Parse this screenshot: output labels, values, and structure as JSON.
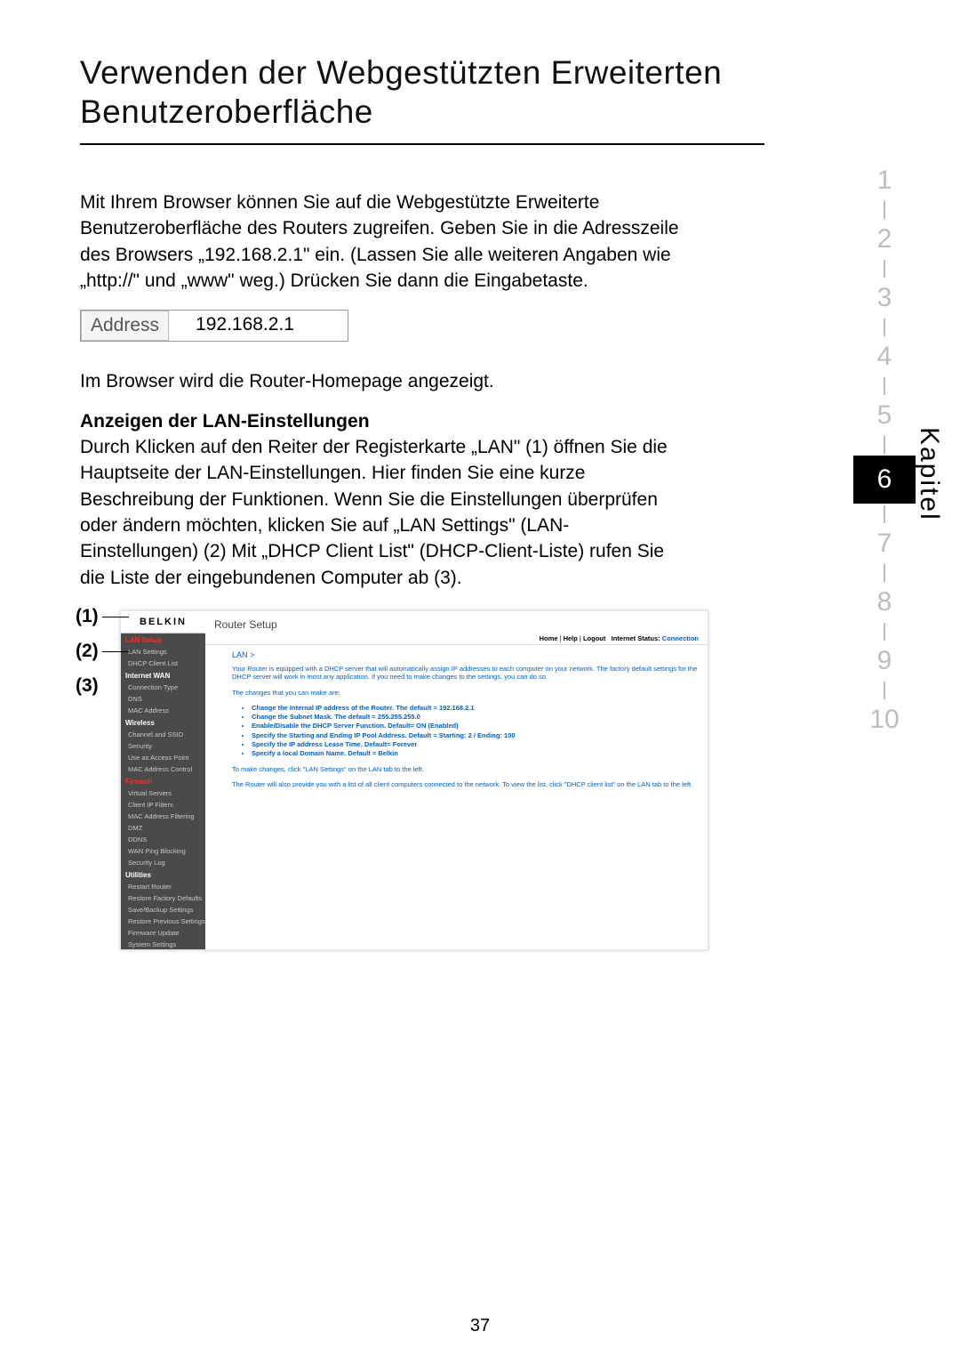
{
  "heading": "Verwenden der Webgestützten Erweiterten Benutzeroberfläche",
  "intro": "Mit Ihrem Browser können Sie auf die Webgestützte Erweiterte Benutzeroberfläche des Routers zugreifen. Geben Sie in die Adresszeile des Browsers „192.168.2.1\" ein. (Lassen Sie alle weiteren Angaben wie „http://\" und „www\" weg.) Drücken Sie dann die Eingabetaste.",
  "address_label": "Address",
  "address_value": "192.168.2.1",
  "after_address": "Im Browser wird die Router-Homepage angezeigt.",
  "subhead": "Anzeigen der LAN-Einstellungen",
  "lan_para": "Durch Klicken auf den Reiter der Registerkarte „LAN\" (1) öffnen Sie die Hauptseite der LAN-Einstellungen. Hier finden Sie eine kurze Beschreibung der Funktionen. Wenn Sie die Einstellungen überprüfen oder ändern möchten, klicken Sie auf „LAN Settings\" (LAN-Einstellungen) (2) Mit „DHCP Client List\" (DHCP-Client-Liste) rufen Sie die Liste der eingebundenen Computer ab (3).",
  "chapter_label": "Kapitel",
  "chapters": {
    "c1": "1",
    "c2": "2",
    "c3": "3",
    "c4": "4",
    "c5": "5",
    "c6": "6",
    "c7": "7",
    "c8": "8",
    "c9": "9",
    "c10": "10"
  },
  "callouts": {
    "n1": "(1)",
    "n2": "(2)",
    "n3": "(3)"
  },
  "router": {
    "logo": "BELKIN",
    "title": "Router Setup",
    "top_home": "Home",
    "top_help": "Help",
    "top_logout": "Logout",
    "top_status_label": "Internet Status:",
    "top_status_value": "Connection",
    "breadcrumb": "LAN >",
    "p1": "Your Router is equipped with a DHCP server that will automatically assign IP addresses to each computer on your network. The factory default settings for the DHCP server will work in most any application. If you need to make changes to the settings, you can do so.",
    "p2": "The changes that you can make are:",
    "bullets": {
      "b1": "Change the Internal IP address of the Router. The default = 192.168.2.1",
      "b2": "Change the Subnet Mask. The default = 255.255.255.0",
      "b3": "Enable/Disable the DHCP Server Function. Default= ON (Enabled)",
      "b4": "Specify the Starting and Ending IP Pool Address. Default = Starting: 2 / Ending: 100",
      "b5": "Specify the IP address Lease Time. Default= Forever",
      "b6": "Specify a local Domain Name. Default = Belkin"
    },
    "p3": "To make changes, click \"LAN Settings\" on the LAN tab to the left.",
    "p4": "The Router will also provide you with a list of all client computers connected to the network. To view the list, click \"DHCP client list\" on the LAN tab to the left.",
    "sidebar": {
      "lan_setup": "LAN Setup",
      "lan_settings": "LAN Settings",
      "dhcp_client": "DHCP Client List",
      "internet_wan": "Internet WAN",
      "conn_type": "Connection Type",
      "dns": "DNS",
      "mac": "MAC Address",
      "wireless": "Wireless",
      "channel": "Channel and SSID",
      "security": "Security",
      "uap": "Use as Access Point",
      "macac": "MAC Address Control",
      "firewall": "Firewall",
      "vservers": "Virtual Servers",
      "cipf": "Client IP Filters",
      "macaf": "MAC Address Filtering",
      "dmz": "DMZ",
      "ddns": "DDNS",
      "wanping": "WAN Ping Blocking",
      "seclog": "Security Log",
      "utilities": "Utilities",
      "restart": "Restart Router",
      "restore": "Restore Factory Defaults",
      "saveback": "Save/Backup Settings",
      "restprev": "Restore Previous Settings",
      "fwupdate": "Firmware Update",
      "sysset": "System Settings"
    }
  },
  "page_number": "37"
}
